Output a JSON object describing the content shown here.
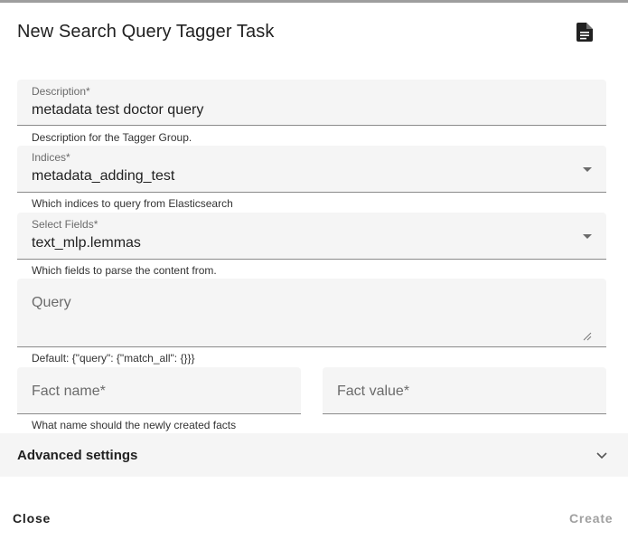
{
  "dialog": {
    "title": "New Search Query Tagger Task",
    "doc_icon": "document-icon"
  },
  "fields": {
    "description": {
      "label": "Description*",
      "value": "metadata test doctor query",
      "hint": "Description for the Tagger Group."
    },
    "indices": {
      "label": "Indices*",
      "value": "metadata_adding_test",
      "hint": "Which indices to query from Elasticsearch"
    },
    "select_fields": {
      "label": "Select Fields*",
      "value": "text_mlp.lemmas",
      "hint": "Which fields to parse the content from."
    },
    "query": {
      "placeholder": "Query",
      "hint": "Default: {\"query\": {\"match_all\": {}}}"
    },
    "fact_name": {
      "placeholder": "Fact name*",
      "hint": "What name should the newly created facts"
    },
    "fact_value": {
      "placeholder": "Fact value*"
    }
  },
  "advanced": {
    "title": "Advanced settings",
    "icon": "chevron-down-icon"
  },
  "actions": {
    "close_label": "Close",
    "create_label": "Create"
  }
}
